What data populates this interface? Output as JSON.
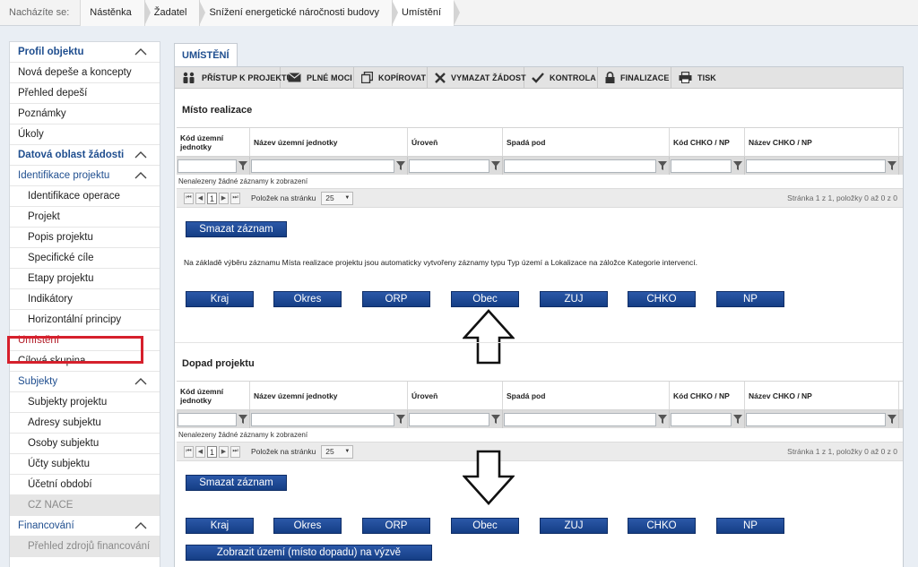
{
  "breadcrumb": {
    "label": "Nacházíte se:",
    "items": [
      "Nástěnka",
      "Žadatel",
      "Snížení energetické náročnosti budovy",
      "Umístění"
    ]
  },
  "sidebar": {
    "items": [
      {
        "label": "Profil objektu",
        "kind": "head",
        "chevron": true
      },
      {
        "label": "Nová depeše a koncepty",
        "kind": "normal"
      },
      {
        "label": "Přehled depeší",
        "kind": "normal"
      },
      {
        "label": "Poznámky",
        "kind": "normal"
      },
      {
        "label": "Úkoly",
        "kind": "normal"
      },
      {
        "label": "Datová oblast žádosti",
        "kind": "head",
        "chevron": true
      },
      {
        "label": "Identifikace projektu",
        "kind": "sec",
        "chevron": true
      },
      {
        "label": "Identifikace operace",
        "kind": "sub"
      },
      {
        "label": "Projekt",
        "kind": "sub"
      },
      {
        "label": "Popis projektu",
        "kind": "sub"
      },
      {
        "label": "Specifické cíle",
        "kind": "sub"
      },
      {
        "label": "Etapy projektu",
        "kind": "sub"
      },
      {
        "label": "Indikátory",
        "kind": "sub"
      },
      {
        "label": "Horizontální principy",
        "kind": "sub"
      },
      {
        "label": "Umístění",
        "kind": "active"
      },
      {
        "label": "Cílová skupina",
        "kind": "normal"
      },
      {
        "label": "Subjekty",
        "kind": "sec",
        "chevron": true
      },
      {
        "label": "Subjekty projektu",
        "kind": "sub"
      },
      {
        "label": "Adresy subjektu",
        "kind": "sub"
      },
      {
        "label": "Osoby subjektu",
        "kind": "sub"
      },
      {
        "label": "Účty subjektu",
        "kind": "sub"
      },
      {
        "label": "Účetní období",
        "kind": "sub"
      },
      {
        "label": "CZ NACE",
        "kind": "disabled"
      },
      {
        "label": "Financování",
        "kind": "sec",
        "chevron": true
      },
      {
        "label": "Přehled zdrojů financování",
        "kind": "disabled-sub"
      }
    ]
  },
  "tab": {
    "label": "UMÍSTĚNÍ"
  },
  "toolbar": [
    {
      "label": "PŘÍSTUP K PROJEKTU",
      "icon": "users-icon"
    },
    {
      "label": "PLNÉ MOCI",
      "icon": "envelope-icon"
    },
    {
      "label": "KOPÍROVAT",
      "icon": "copy-icon"
    },
    {
      "label": "VYMAZAT ŽÁDOST",
      "icon": "x-icon"
    },
    {
      "label": "KONTROLA",
      "icon": "check-icon"
    },
    {
      "label": "FINALIZACE",
      "icon": "lock-icon"
    },
    {
      "label": "TISK",
      "icon": "printer-icon"
    }
  ],
  "sections": [
    {
      "title": "Místo realizace",
      "columns": [
        "Kód územní jednotky",
        "Název územní jednotky",
        "Úroveň",
        "Spadá pod",
        "Kód CHKO / NP",
        "Název CHKO / NP"
      ],
      "empty": "Nenalezeny žádné záznamy k zobrazení",
      "page": "1",
      "per_page_label": "Položek na stránku",
      "per_page": "25",
      "page_info": "Stránka 1 z 1, položky 0 až 0 z 0",
      "delete_label": "Smazat záznam",
      "note": "Na základě výběru záznamu Místa realizace projektu jsou automaticky vytvořeny záznamy typu Typ území a Lokalizace na záložce Kategorie intervencí.",
      "buttons": [
        "Kraj",
        "Okres",
        "ORP",
        "Obec",
        "ZUJ",
        "CHKO",
        "NP"
      ]
    },
    {
      "title": "Dopad projektu",
      "columns": [
        "Kód územní jednotky",
        "Název územní jednotky",
        "Úroveň",
        "Spadá pod",
        "Kód CHKO / NP",
        "Název CHKO / NP"
      ],
      "empty": "Nenalezeny žádné záznamy k zobrazení",
      "page": "1",
      "per_page_label": "Položek na stránku",
      "per_page": "25",
      "page_info": "Stránka 1 z 1, položky 0 až 0 z 0",
      "delete_label": "Smazat záznam",
      "buttons": [
        "Kraj",
        "Okres",
        "ORP",
        "Obec",
        "ZUJ",
        "CHKO",
        "NP"
      ],
      "show_label": "Zobrazit území (místo dopadu) na výzvě"
    }
  ]
}
